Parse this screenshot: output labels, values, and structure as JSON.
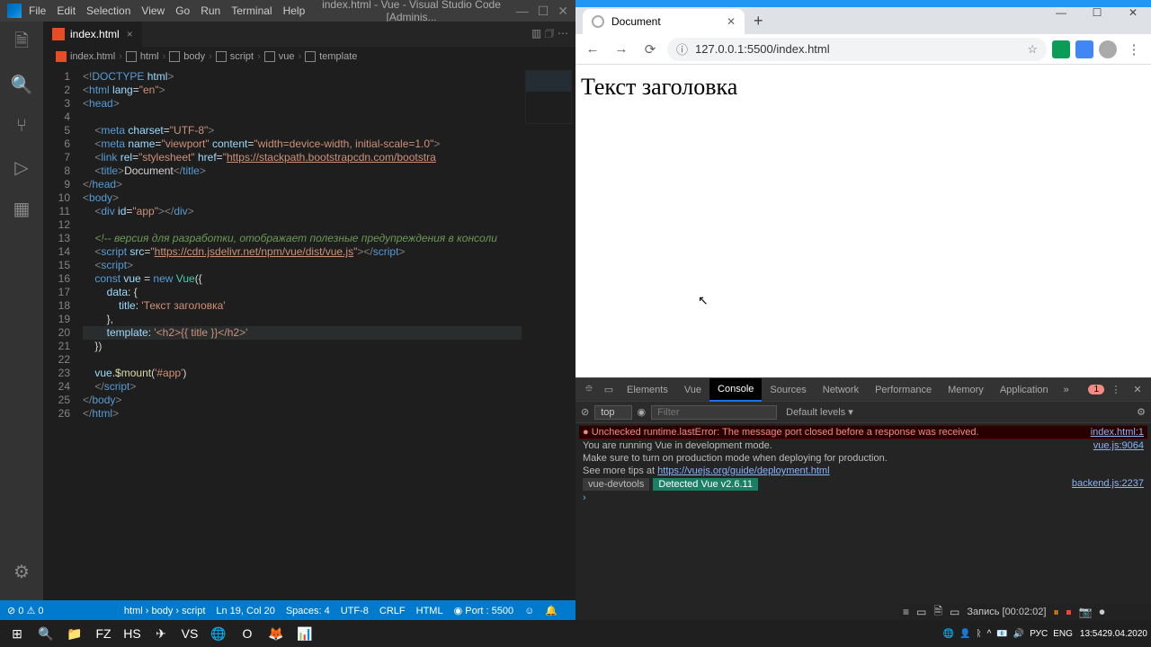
{
  "vscode": {
    "menu": [
      "File",
      "Edit",
      "Selection",
      "View",
      "Go",
      "Run",
      "Terminal",
      "Help"
    ],
    "title": "index.html - Vue - Visual Studio Code [Adminis...",
    "tab": {
      "name": "index.html"
    },
    "breadcrumb": [
      "index.html",
      "html",
      "body",
      "script",
      "vue",
      "template"
    ],
    "code": [
      {
        "n": "1",
        "h": "<span class=g>&lt;!</span><span class=t>DOCTYPE</span> <span class=a>html</span><span class=g>&gt;</span>"
      },
      {
        "n": "2",
        "h": "<span class=g>&lt;</span><span class=t>html</span> <span class=a>lang</span>=<span class=s>\"en\"</span><span class=g>&gt;</span>"
      },
      {
        "n": "3",
        "h": "<span class=g>&lt;</span><span class=t>head</span><span class=g>&gt;</span>"
      },
      {
        "n": "4",
        "h": ""
      },
      {
        "n": "5",
        "h": "    <span class=g>&lt;</span><span class=t>meta</span> <span class=a>charset</span>=<span class=s>\"UTF-8\"</span><span class=g>&gt;</span>"
      },
      {
        "n": "6",
        "h": "    <span class=g>&lt;</span><span class=t>meta</span> <span class=a>name</span>=<span class=s>\"viewport\"</span> <span class=a>content</span>=<span class=s>\"width=device-width, initial-scale=1.0\"</span><span class=g>&gt;</span>"
      },
      {
        "n": "7",
        "h": "    <span class=g>&lt;</span><span class=t>link</span> <span class=a>rel</span>=<span class=s>\"stylesheet\"</span> <span class=a>href</span>=<span class=s>\"<span class=u>https://stackpath.bootstrapcdn.com/bootstra</span></span>"
      },
      {
        "n": "8",
        "h": "    <span class=g>&lt;</span><span class=t>title</span><span class=g>&gt;</span>Document<span class=g>&lt;/</span><span class=t>title</span><span class=g>&gt;</span>"
      },
      {
        "n": "9",
        "h": "<span class=g>&lt;/</span><span class=t>head</span><span class=g>&gt;</span>"
      },
      {
        "n": "10",
        "h": "<span class=g>&lt;</span><span class=t>body</span><span class=g>&gt;</span>"
      },
      {
        "n": "11",
        "h": "    <span class=g>&lt;</span><span class=t>div</span> <span class=a>id</span>=<span class=s>\"app\"</span><span class=g>&gt;&lt;/</span><span class=t>div</span><span class=g>&gt;</span>"
      },
      {
        "n": "12",
        "h": ""
      },
      {
        "n": "13",
        "h": "    <span class=c>&lt;!-- версия для разработки, отображает полезные предупреждения в консоли</span>"
      },
      {
        "n": "14",
        "h": "    <span class=g>&lt;</span><span class=t>script</span> <span class=a>src</span>=<span class=s>\"<span class=u>https://cdn.jsdelivr.net/npm/vue/dist/vue.js</span>\"</span><span class=g>&gt;&lt;/</span><span class=t>script</span><span class=g>&gt;</span>"
      },
      {
        "n": "15",
        "h": "    <span class=g>&lt;</span><span class=t>script</span><span class=g>&gt;</span>"
      },
      {
        "n": "16",
        "h": "    <span class=k>const</span> <span class=v>vue</span> = <span class=k>new</span> <span class=o>Vue</span>({"
      },
      {
        "n": "17",
        "h": "        <span class=v>data</span>: {"
      },
      {
        "n": "18",
        "h": "            <span class=v>title</span>: <span class=s>'Текст заголовка'</span>"
      },
      {
        "n": "19",
        "h": "        },"
      },
      {
        "n": "20",
        "hl": true,
        "h": "        <span class=v>template</span>: <span class=s>'&lt;h2&gt;{{ title }}&lt;/h2&gt;'</span>"
      },
      {
        "n": "21",
        "h": "    })"
      },
      {
        "n": "22",
        "h": ""
      },
      {
        "n": "23",
        "h": "    <span class=v>vue</span>.<span class=f>$mount</span>(<span class=s>'#app'</span>)"
      },
      {
        "n": "24",
        "h": "    <span class=g>&lt;/</span><span class=t>script</span><span class=g>&gt;</span>"
      },
      {
        "n": "25",
        "h": "<span class=g>&lt;/</span><span class=t>body</span><span class=g>&gt;</span>"
      },
      {
        "n": "26",
        "h": "<span class=g>&lt;/</span><span class=t>html</span><span class=g>&gt;</span>"
      }
    ],
    "status": {
      "left": [
        "⊘ 0 ⚠ 0"
      ],
      "right": [
        "html › body › script",
        "Ln 19, Col 20",
        "Spaces: 4",
        "UTF-8",
        "CRLF",
        "HTML",
        "◉ Port : 5500",
        "☺",
        "🔔"
      ]
    }
  },
  "chrome": {
    "tab": "Document",
    "url": "127.0.0.1:5500/index.html",
    "heading": "Текст заголовка"
  },
  "devtools": {
    "tabs": [
      "Elements",
      "Vue",
      "Console",
      "Sources",
      "Network",
      "Performance",
      "Memory",
      "Application"
    ],
    "active": "Console",
    "err_count": "1",
    "ctx": "top",
    "filter": "Filter",
    "levels": "Default levels ▾",
    "lines": [
      {
        "cls": "err",
        "txt": "● Unchecked runtime.lastError: The message port closed before a response was received.",
        "src": "index.html:1"
      },
      {
        "cls": "info",
        "txt": "You are running Vue in development mode.",
        "src": "vue.js:9064"
      },
      {
        "cls": "info",
        "txt": "Make sure to turn on production mode when deploying for production.",
        "src": ""
      },
      {
        "cls": "info",
        "txt": "See more tips at <span class=lnk>https://vuejs.org/guide/deployment.html</span>",
        "src": ""
      },
      {
        "cls": "badge",
        "b1": "vue-devtools",
        "b2": "Detected Vue v2.6.11",
        "src": "backend.js:2237"
      },
      {
        "cls": "prompt",
        "txt": "›",
        "src": ""
      }
    ]
  },
  "recbar": {
    "label": "Запись [00:02:02]"
  },
  "taskbar": {
    "icons": [
      "⊞",
      "🔍",
      "📁",
      "FZ",
      "HS",
      "✈",
      "VS",
      "🌐",
      "O",
      "🦊",
      "📊"
    ],
    "tray": [
      "🌐",
      "👤",
      "ᚱ",
      "^",
      "📧",
      "🔊",
      "РУС",
      "ENG"
    ],
    "time": "13:54",
    "date": "29.04.2020"
  }
}
